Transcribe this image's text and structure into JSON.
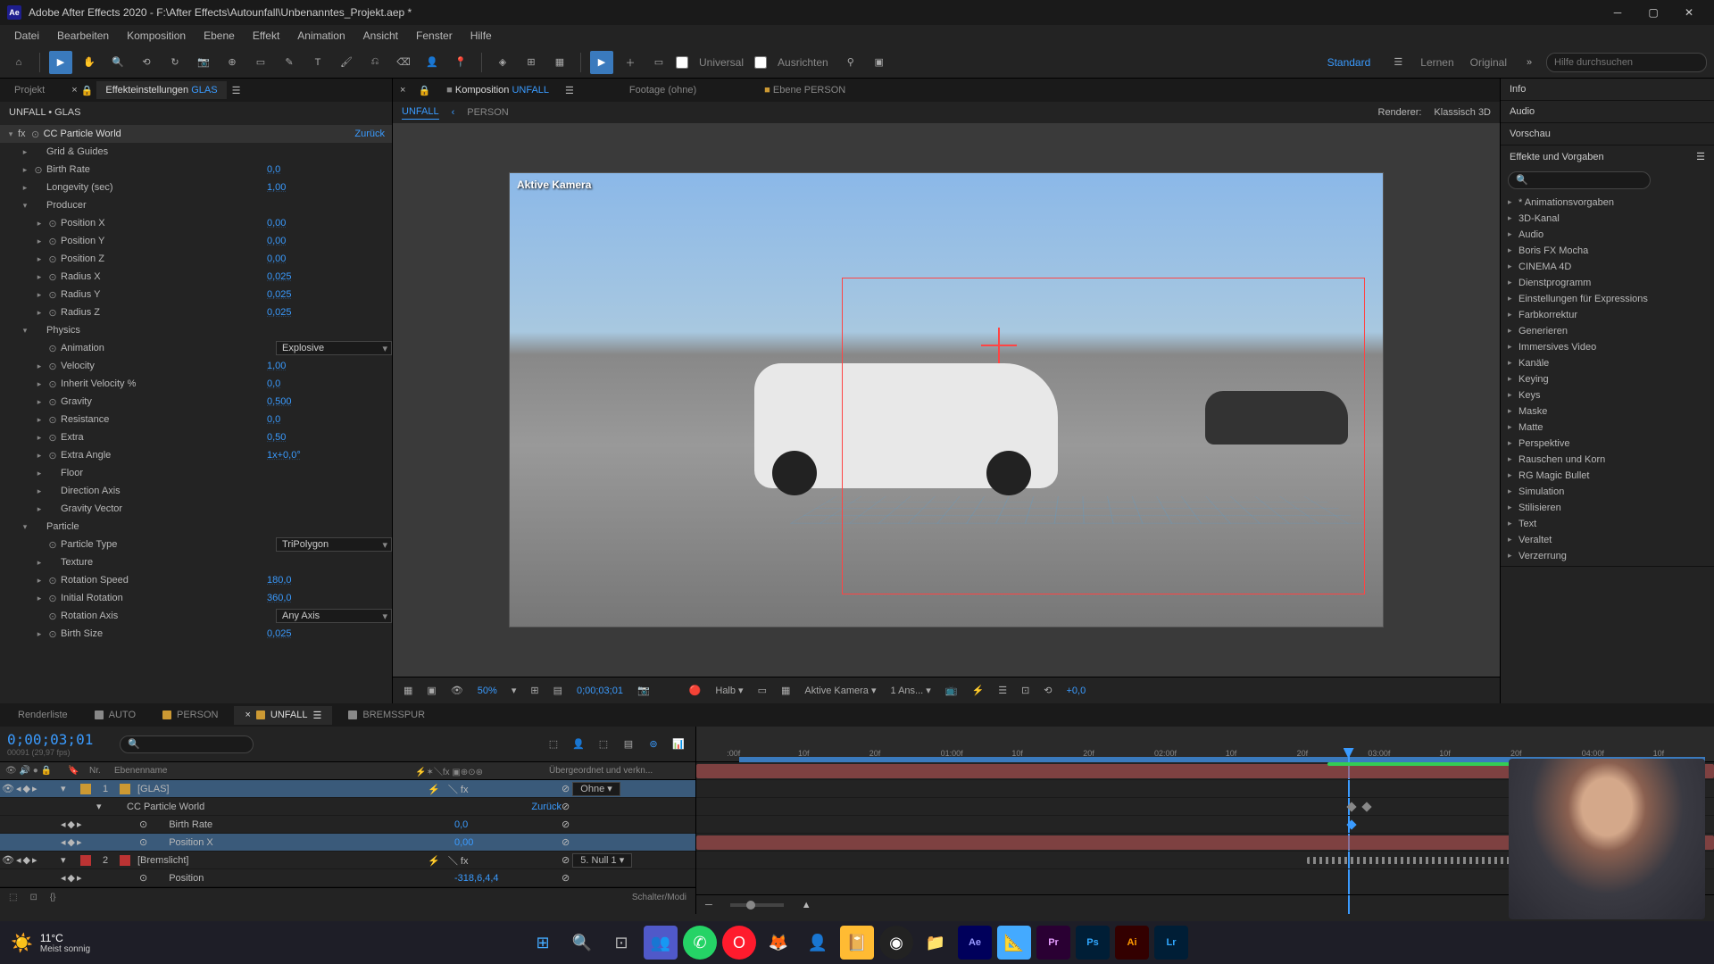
{
  "app": {
    "name": "Adobe After Effects 2020",
    "file": "F:\\After Effects\\Autounfall\\Unbenanntes_Projekt.aep *"
  },
  "menu": [
    "Datei",
    "Bearbeiten",
    "Komposition",
    "Ebene",
    "Effekt",
    "Animation",
    "Ansicht",
    "Fenster",
    "Hilfe"
  ],
  "toolbar": {
    "universal": "Universal",
    "ausrichten": "Ausrichten",
    "workspaces": [
      "Standard",
      "Lernen",
      "Original"
    ],
    "search_placeholder": "Hilfe durchsuchen"
  },
  "leftpanel": {
    "tabs": {
      "projekt": "Projekt",
      "effekte": "Effekteinstellungen",
      "layer": "GLAS"
    },
    "breadcrumb": "UNFALL • GLAS",
    "effect": {
      "name": "CC Particle World",
      "reset": "Zurück"
    },
    "props": [
      {
        "indent": 1,
        "arrow": "▸",
        "name": "Grid & Guides",
        "val": ""
      },
      {
        "indent": 1,
        "arrow": "▸",
        "stop": true,
        "name": "Birth Rate",
        "val": "0,0"
      },
      {
        "indent": 1,
        "arrow": "▸",
        "name": "Longevity (sec)",
        "val": "1,00"
      },
      {
        "indent": 1,
        "arrow": "▾",
        "name": "Producer",
        "val": "",
        "group": true
      },
      {
        "indent": 2,
        "arrow": "▸",
        "stop": true,
        "name": "Position X",
        "val": "0,00"
      },
      {
        "indent": 2,
        "arrow": "▸",
        "stop": true,
        "name": "Position Y",
        "val": "0,00"
      },
      {
        "indent": 2,
        "arrow": "▸",
        "stop": true,
        "name": "Position Z",
        "val": "0,00"
      },
      {
        "indent": 2,
        "arrow": "▸",
        "stop": true,
        "name": "Radius X",
        "val": "0,025"
      },
      {
        "indent": 2,
        "arrow": "▸",
        "stop": true,
        "name": "Radius Y",
        "val": "0,025"
      },
      {
        "indent": 2,
        "arrow": "▸",
        "stop": true,
        "name": "Radius Z",
        "val": "0,025"
      },
      {
        "indent": 1,
        "arrow": "▾",
        "name": "Physics",
        "val": "",
        "group": true
      },
      {
        "indent": 2,
        "arrow": "",
        "stop": true,
        "name": "Animation",
        "val": "Explosive",
        "select": true
      },
      {
        "indent": 2,
        "arrow": "▸",
        "stop": true,
        "name": "Velocity",
        "val": "1,00"
      },
      {
        "indent": 2,
        "arrow": "▸",
        "stop": true,
        "name": "Inherit Velocity %",
        "val": "0,0"
      },
      {
        "indent": 2,
        "arrow": "▸",
        "stop": true,
        "name": "Gravity",
        "val": "0,500"
      },
      {
        "indent": 2,
        "arrow": "▸",
        "stop": true,
        "name": "Resistance",
        "val": "0,0"
      },
      {
        "indent": 2,
        "arrow": "▸",
        "stop": true,
        "name": "Extra",
        "val": "0,50"
      },
      {
        "indent": 2,
        "arrow": "▸",
        "stop": true,
        "name": "Extra Angle",
        "val": "1x+0,0°"
      },
      {
        "indent": 2,
        "arrow": "▸",
        "name": "Floor",
        "val": ""
      },
      {
        "indent": 2,
        "arrow": "▸",
        "name": "Direction Axis",
        "val": ""
      },
      {
        "indent": 2,
        "arrow": "▸",
        "name": "Gravity Vector",
        "val": ""
      },
      {
        "indent": 1,
        "arrow": "▾",
        "name": "Particle",
        "val": "",
        "group": true
      },
      {
        "indent": 2,
        "arrow": "",
        "stop": true,
        "name": "Particle Type",
        "val": "TriPolygon",
        "select": true
      },
      {
        "indent": 2,
        "arrow": "▸",
        "name": "Texture",
        "val": ""
      },
      {
        "indent": 2,
        "arrow": "▸",
        "stop": true,
        "name": "Rotation Speed",
        "val": "180,0"
      },
      {
        "indent": 2,
        "arrow": "▸",
        "stop": true,
        "name": "Initial Rotation",
        "val": "360,0"
      },
      {
        "indent": 2,
        "arrow": "",
        "stop": true,
        "name": "Rotation Axis",
        "val": "Any Axis",
        "select": true
      },
      {
        "indent": 2,
        "arrow": "▸",
        "stop": true,
        "name": "Birth Size",
        "val": "0,025"
      }
    ]
  },
  "comp": {
    "tabs": {
      "komposition": "Komposition",
      "name": "UNFALL",
      "footage": "Footage",
      "footage_val": "(ohne)",
      "ebene": "Ebene",
      "ebene_val": "PERSON"
    },
    "breadcrumb": [
      "UNFALL",
      "PERSON"
    ],
    "renderer_label": "Renderer:",
    "renderer": "Klassisch 3D",
    "viewport_label": "Aktive Kamera",
    "controls": {
      "zoom": "50%",
      "timecode": "0;00;03;01",
      "res": "Halb",
      "view": "Aktive Kamera",
      "views": "1 Ans...",
      "exposure": "+0,0"
    }
  },
  "rightpanel": {
    "sections": [
      "Info",
      "Audio",
      "Vorschau"
    ],
    "effects_header": "Effekte und Vorgaben",
    "search_placeholder": "",
    "categories": [
      "* Animationsvorgaben",
      "3D-Kanal",
      "Audio",
      "Boris FX Mocha",
      "CINEMA 4D",
      "Dienstprogramm",
      "Einstellungen für Expressions",
      "Farbkorrektur",
      "Generieren",
      "Immersives Video",
      "Kanäle",
      "Keying",
      "Keys",
      "Maske",
      "Matte",
      "Perspektive",
      "Rauschen und Korn",
      "RG Magic Bullet",
      "Simulation",
      "Stilisieren",
      "Text",
      "Veraltet",
      "Verzerrung"
    ]
  },
  "timeline": {
    "tabs": [
      {
        "label": "Renderliste",
        "color": ""
      },
      {
        "label": "AUTO",
        "color": "#888"
      },
      {
        "label": "PERSON",
        "color": "#c93"
      },
      {
        "label": "UNFALL",
        "color": "#c93",
        "active": true
      },
      {
        "label": "BREMSSPUR",
        "color": "#888"
      }
    ],
    "timecode": "0;00;03;01",
    "frames": "00091 (29,97 fps)",
    "ruler": [
      ":00f",
      "10f",
      "20f",
      "01:00f",
      "10f",
      "20f",
      "02:00f",
      "10f",
      "20f",
      "03:00f",
      "10f",
      "20f",
      "04:00f",
      "10f"
    ],
    "columns": {
      "nr": "Nr.",
      "name": "Ebenenname",
      "parent": "Übergeordnet und verkn..."
    },
    "layers": [
      {
        "num": "1",
        "color": "#c93",
        "name": "[GLAS]",
        "parent": "Ohne",
        "selected": true
      },
      {
        "prop": true,
        "name": "CC Particle World",
        "reset": "Zurück"
      },
      {
        "prop": true,
        "sub": true,
        "stop": true,
        "name": "Birth Rate",
        "val": "0,0"
      },
      {
        "prop": true,
        "sub": true,
        "stop": true,
        "name": "Position X",
        "val": "0,00",
        "selected": true
      },
      {
        "num": "2",
        "color": "#b33",
        "name": "[Bremslicht]",
        "parent": "5. Null 1"
      },
      {
        "prop": true,
        "sub": true,
        "stop": true,
        "name": "Position",
        "val": "-318,6,4,4"
      }
    ],
    "footer_label": "Schalter/Modi"
  },
  "taskbar": {
    "temp": "11°C",
    "weather": "Meist sonnig"
  }
}
